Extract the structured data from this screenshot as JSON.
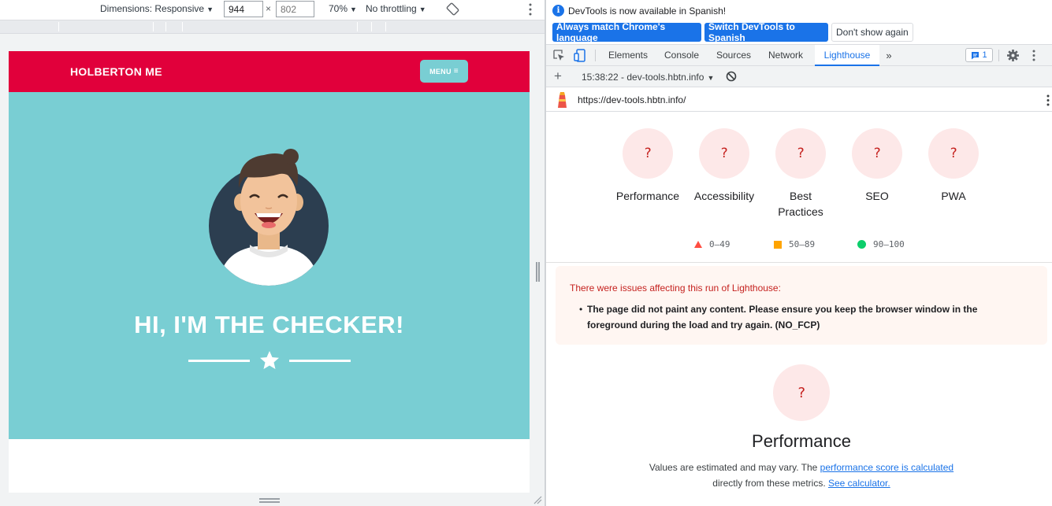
{
  "device_toolbar": {
    "dimensions_label": "Dimensions: Responsive",
    "width": "944",
    "height": "802",
    "times_symbol": "×",
    "zoom": "70%",
    "throttling": "No throttling",
    "caret": "▼"
  },
  "site": {
    "brand": "HOLBERTON ME",
    "menu_label": "MENU",
    "hero_title": "HI, I'M THE CHECKER!",
    "colors": {
      "nav": "#e1003b",
      "hero": "#79ced3"
    }
  },
  "devtools": {
    "infobar": {
      "message": "DevTools is now available in Spanish!",
      "btn_match": "Always match Chrome's language",
      "btn_switch": "Switch DevTools to Spanish",
      "btn_dont_show": "Don't show again"
    },
    "tabs": {
      "elements": "Elements",
      "console": "Console",
      "sources": "Sources",
      "network": "Network",
      "lighthouse": "Lighthouse",
      "more": "»"
    },
    "issues_count": "1",
    "lighthouse": {
      "report_select": "15:38:22 - dev-tools.hbtn.info",
      "url": "https://dev-tools.hbtn.info/",
      "gauges": [
        {
          "label": "Performance",
          "score": "?"
        },
        {
          "label": "Accessibility",
          "score": "?"
        },
        {
          "label": "Best Practices",
          "score": "?"
        },
        {
          "label": "SEO",
          "score": "?"
        },
        {
          "label": "PWA",
          "score": "?"
        }
      ],
      "legend": {
        "fail": "0–49",
        "average": "50–89",
        "pass": "90–100"
      },
      "warning_title": "There were issues affecting this run of Lighthouse:",
      "warning_item": "The page did not paint any content. Please ensure you keep the browser window in the foreground during the load and try again. (NO_FCP)",
      "category_title": "Performance",
      "category_score": "?",
      "desc_prefix": "Values are estimated and may vary. The ",
      "desc_link1": "performance score is calculated",
      "desc_middle": "directly from these metrics. ",
      "desc_link2": "See calculator."
    }
  }
}
